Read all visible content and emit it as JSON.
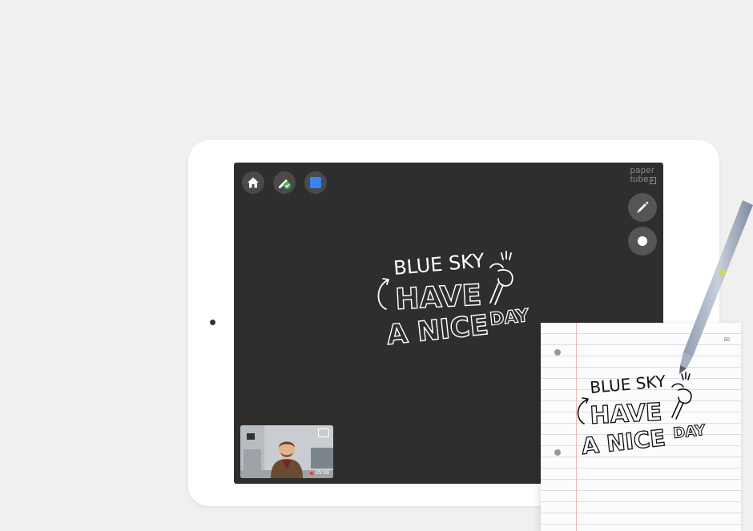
{
  "app": {
    "logo_line1": "paper",
    "logo_line2": "tube"
  },
  "toolbar": {
    "home_icon": "home-icon",
    "pen_check_icon": "pen-check-icon",
    "color_swatch": "#3b82f6"
  },
  "sidebar": {
    "marker_icon": "marker-icon",
    "brush_size_icon": "dot-icon"
  },
  "canvas": {
    "line1": "BLUE SKY",
    "line2": "HAVE",
    "line3": "A NICE",
    "line4": "DAY"
  },
  "video": {
    "timer": "05:08",
    "camera_icon": "camera-switch-icon"
  },
  "paper_note": {
    "line1": "BLUE SKY",
    "line2": "HAVE",
    "line3": "A NICE",
    "line4": "DAY"
  },
  "colors": {
    "screen_bg": "#2e2e2e",
    "accent_blue": "#3b82f6",
    "check_green": "#4caf50",
    "record_red": "#e53935"
  }
}
